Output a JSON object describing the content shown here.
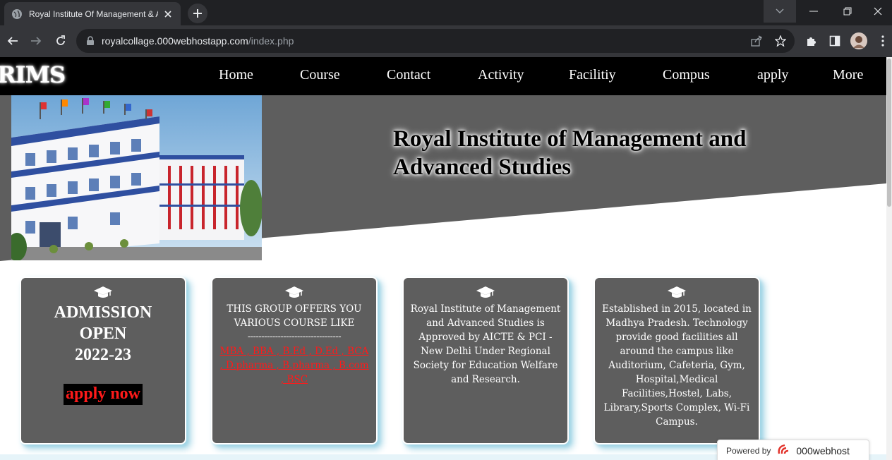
{
  "browser": {
    "tab_title": "Royal Institute Of Management & Advanced Studies",
    "url_domain": "royalcollage.000webhostapp.com",
    "url_path": "/index.php"
  },
  "site": {
    "logo": "RIMS",
    "nav": [
      "Home",
      "Course",
      "Contact",
      "Activity",
      "Facilitiy",
      "Compus",
      "apply",
      "More"
    ],
    "hero_title_line1": "Royal Institute of Management and",
    "hero_title_line2": "Advanced Studies"
  },
  "cards": {
    "admission": {
      "line1": "ADMISSION",
      "line2": "OPEN",
      "line3": "2022-23",
      "button": "apply now"
    },
    "courses": {
      "text": "THIS GROUP OFFERS YOU VARIOUS COURSE LIKE",
      "divider": "----------------------------------",
      "list": "MBA , BBA , B.Ed , D.Ed , BCA , D.pharma , B.pharma , B.com , BSC"
    },
    "approval": {
      "text": "Royal Institute of Management and Advanced Studies is Approved by AICTE & PCI - New Delhi Under Regional Society for Education Welfare and Research."
    },
    "established": {
      "text": "Established in 2015, located in Madhya Pradesh. Technology provide good facilities all around the campus like Auditorium, Cafeteria, Gym, Hospital,Medical Facilities,Hostel, Labs, Library,Sports Complex, Wi-Fi Campus."
    }
  },
  "badge": {
    "powered_by": "Powered by",
    "brand": "000webhost"
  },
  "colors": {
    "nav_bg": "#000000",
    "hero_grey": "#5e5e5e",
    "card_bg": "#5e5e5e",
    "card_shadow": "#9fd3e4",
    "accent_red": "#ff1a1a"
  }
}
